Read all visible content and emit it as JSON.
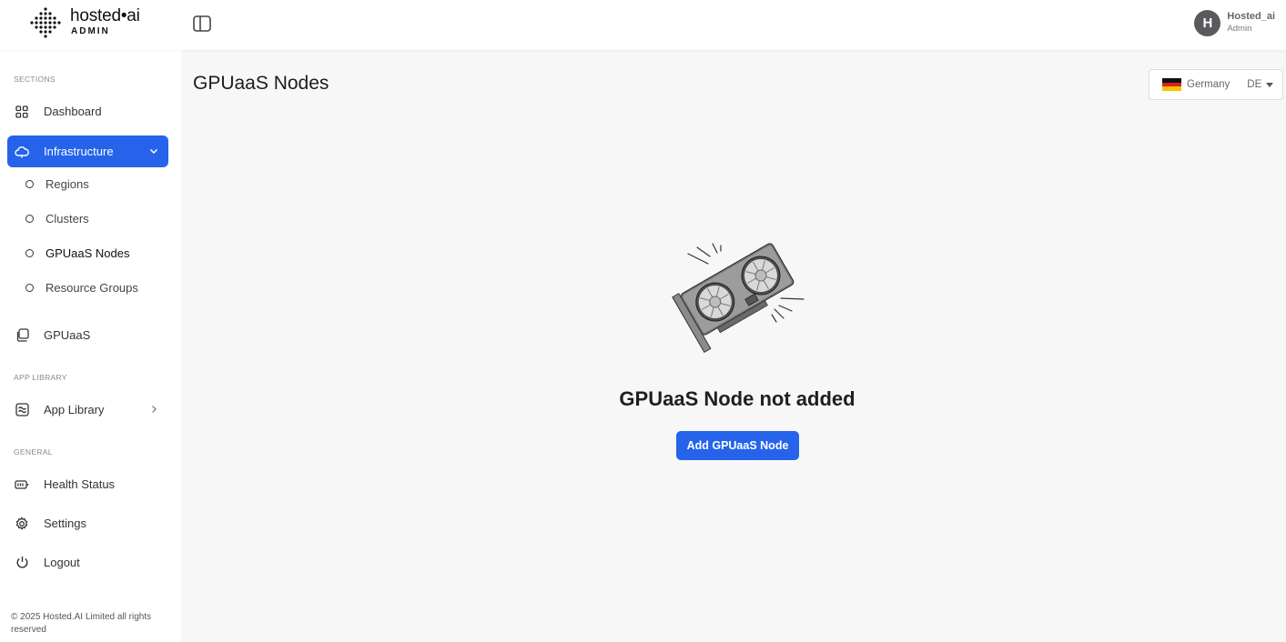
{
  "header": {
    "logo_name": "hosted•ai",
    "logo_sub": "ADMIN",
    "user_initial": "H",
    "user_name": "Hosted_ai",
    "user_role": "Admin"
  },
  "sidebar": {
    "sections_label": "SECTIONS",
    "dashboard": "Dashboard",
    "infrastructure": "Infrastructure",
    "sub_items": [
      "Regions",
      "Clusters",
      "GPUaaS Nodes",
      "Resource Groups"
    ],
    "gpuaas": "GPUaaS",
    "app_library_label": "APP LIBRARY",
    "app_library": "App Library",
    "general_label": "GENERAL",
    "health_status": "Health Status",
    "settings": "Settings",
    "logout": "Logout",
    "footer": "© 2025 Hosted.AI Limited all rights reserved"
  },
  "main": {
    "title": "GPUaaS Nodes",
    "region": {
      "country": "Germany",
      "code": "DE"
    },
    "empty_title": "GPUaaS Node not added",
    "add_button": "Add GPUaaS Node"
  },
  "colors": {
    "accent": "#2563eb",
    "background": "#f7f7f8",
    "sidebar": "#ffffff"
  },
  "icons": [
    "dots-logo-icon",
    "sidebar-toggle-icon",
    "grid-icon",
    "cloud-icon",
    "chevron-down-icon",
    "copy-icon",
    "app-library-icon",
    "chevron-right-icon",
    "battery-icon",
    "gear-icon",
    "power-icon",
    "flag-germany-icon",
    "caret-down-icon",
    "gpu-card-illustration"
  ]
}
